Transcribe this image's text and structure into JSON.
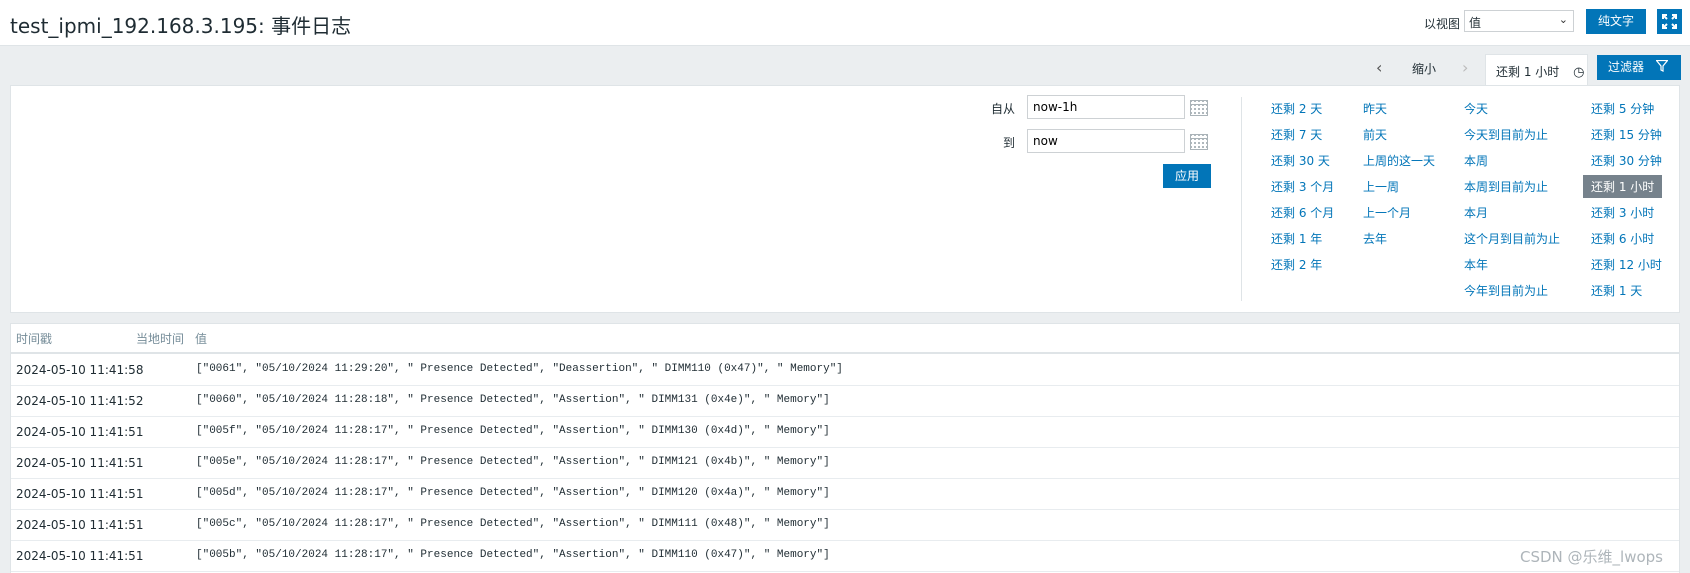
{
  "header": {
    "title": "test_ipmi_192.168.3.195: 事件日志",
    "view_label": "以视图",
    "view_select_value": "值",
    "plain_text_button": "纯文字",
    "fullscreen_icon": "fullscreen-icon"
  },
  "filter_tabs": {
    "zoom_out": "缩小",
    "time_tab_label": "还剩 1 小时",
    "filter_button": "过滤器"
  },
  "filter_panel": {
    "from_label": "自从",
    "from_value": "now-1h",
    "to_label": "到",
    "to_value": "now",
    "apply_button": "应用",
    "quick_ranges": [
      [
        "还剩 2 天",
        "还剩 7 天",
        "还剩 30 天",
        "还剩 3 个月",
        "还剩 6 个月",
        "还剩 1 年",
        "还剩 2 年"
      ],
      [
        "昨天",
        "前天",
        "上周的这一天",
        "上一周",
        "上一个月",
        "去年"
      ],
      [
        "今天",
        "今天到目前为止",
        "本周",
        "本周到目前为止",
        "本月",
        "这个月到目前为止",
        "本年",
        "今年到目前为止"
      ],
      [
        "还剩 5 分钟",
        "还剩 15 分钟",
        "还剩 30 分钟",
        "还剩 1 小时",
        "还剩 3 小时",
        "还剩 6 小时",
        "还剩 12 小时",
        "还剩 1 天"
      ]
    ],
    "active_range": "还剩 1 小时"
  },
  "table": {
    "columns": [
      "时间戳",
      "当地时间",
      "值"
    ],
    "rows": [
      {
        "timestamp": "2024-05-10 11:41:58",
        "value": "[\"0061\", \"05/10/2024 11:29:20\", \" Presence Detected\", \"Deassertion\", \" DIMM110 (0x47)\", \" Memory\"]"
      },
      {
        "timestamp": "2024-05-10 11:41:52",
        "value": "[\"0060\", \"05/10/2024 11:28:18\", \" Presence Detected\", \"Assertion\", \" DIMM131 (0x4e)\", \" Memory\"]"
      },
      {
        "timestamp": "2024-05-10 11:41:51",
        "value": "[\"005f\", \"05/10/2024 11:28:17\", \" Presence Detected\", \"Assertion\", \" DIMM130 (0x4d)\", \" Memory\"]"
      },
      {
        "timestamp": "2024-05-10 11:41:51",
        "value": "[\"005e\", \"05/10/2024 11:28:17\", \" Presence Detected\", \"Assertion\", \" DIMM121 (0x4b)\", \" Memory\"]"
      },
      {
        "timestamp": "2024-05-10 11:41:51",
        "value": "[\"005d\", \"05/10/2024 11:28:17\", \" Presence Detected\", \"Assertion\", \" DIMM120 (0x4a)\", \" Memory\"]"
      },
      {
        "timestamp": "2024-05-10 11:41:51",
        "value": "[\"005c\", \"05/10/2024 11:28:17\", \" Presence Detected\", \"Assertion\", \" DIMM111 (0x48)\", \" Memory\"]"
      },
      {
        "timestamp": "2024-05-10 11:41:51",
        "value": "[\"005b\", \"05/10/2024 11:28:17\", \" Presence Detected\", \"Assertion\", \" DIMM110 (0x47)\", \" Memory\"]"
      }
    ]
  },
  "watermark": "CSDN @乐维_lwops",
  "colors": {
    "accent": "#0275b8",
    "active_range_bg": "#76828c",
    "background": "#ebeef0"
  }
}
